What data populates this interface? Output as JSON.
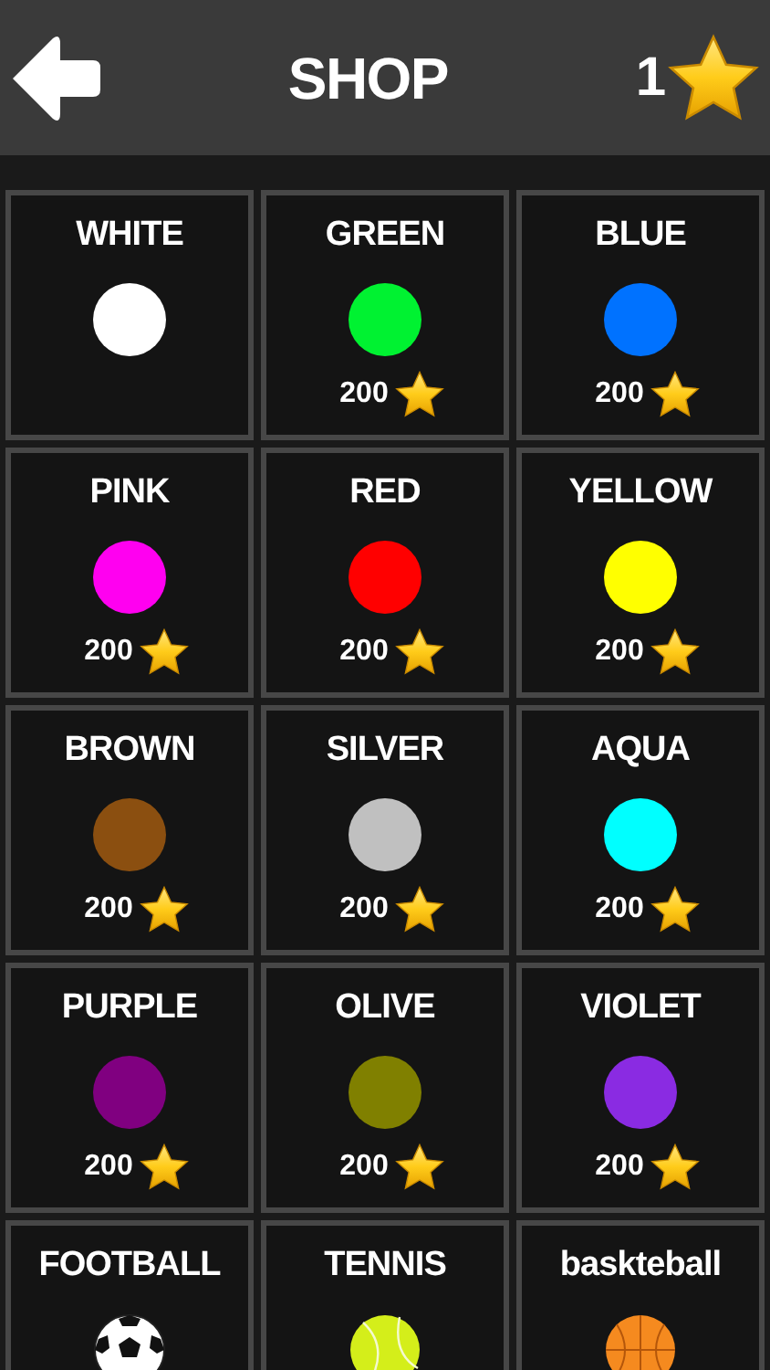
{
  "header": {
    "title": "SHOP",
    "stars_count": "1"
  },
  "items": [
    {
      "kind": "color",
      "name": "WHITE",
      "color": "#ffffff"
    },
    {
      "kind": "color",
      "name": "GREEN",
      "color": "#00f231",
      "price": "200"
    },
    {
      "kind": "color",
      "name": "BLUE",
      "color": "#0072ff",
      "price": "200"
    },
    {
      "kind": "color",
      "name": "PINK",
      "color": "#ff00f0",
      "price": "200"
    },
    {
      "kind": "color",
      "name": "RED",
      "color": "#ff0000",
      "price": "200"
    },
    {
      "kind": "color",
      "name": "YELLOW",
      "color": "#ffff00",
      "price": "200"
    },
    {
      "kind": "color",
      "name": "BROWN",
      "color": "#8b4f10",
      "price": "200"
    },
    {
      "kind": "color",
      "name": "SILVER",
      "color": "#c0c0c0",
      "price": "200"
    },
    {
      "kind": "color",
      "name": "AQUA",
      "color": "#00ffff",
      "price": "200"
    },
    {
      "kind": "color",
      "name": "PURPLE",
      "color": "#800080",
      "price": "200"
    },
    {
      "kind": "color",
      "name": "OLIVE",
      "color": "#808000",
      "price": "200"
    },
    {
      "kind": "color",
      "name": "VIOLET",
      "color": "#8a2be2",
      "price": "200"
    },
    {
      "kind": "soccer",
      "name": "FOOTBALL"
    },
    {
      "kind": "tennis",
      "name": "TENNIS"
    },
    {
      "kind": "basketball",
      "name": "baskteball"
    }
  ]
}
